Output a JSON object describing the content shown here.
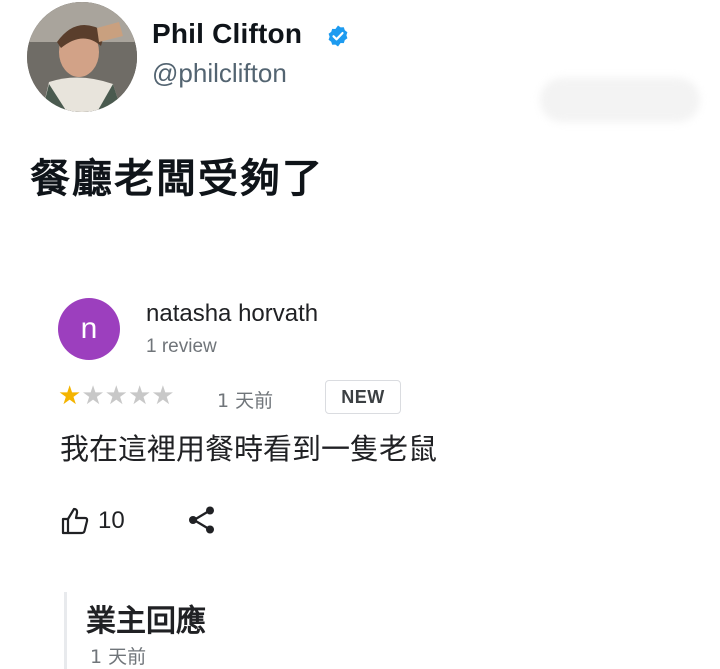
{
  "tweet": {
    "author_name": "Phil Clifton",
    "handle": "@philclifton",
    "text": "餐廳老闆受夠了",
    "verified_icon": "verified-badge-icon"
  },
  "review": {
    "avatar_letter": "n",
    "avatar_color": "#9c3fbe",
    "reviewer_name": "natasha horvath",
    "review_count": "1 review",
    "rating": 1,
    "rating_max": 5,
    "time": "1 天前",
    "badge": "NEW",
    "text": "我在這裡用餐時看到一隻老鼠",
    "like_count": "10"
  },
  "owner_reply": {
    "title": "業主回應",
    "time": "1 天前"
  }
}
